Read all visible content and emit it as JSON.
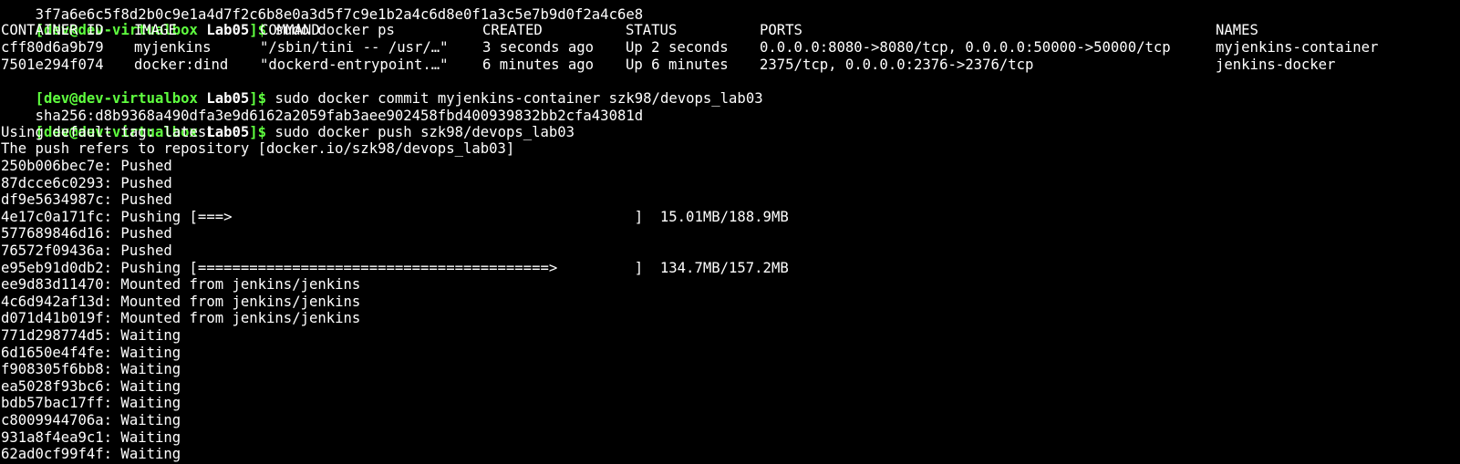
{
  "terminal": {
    "partial_top": "3f7a6e6c5f8d2b0c9e1a4d7f2c6b8e0a3d5f7c9e1b2a4c6d8e0f1a3c5e7b9d0f2a4c6e8",
    "prompt": {
      "user_host": "[dev@dev-virtualbox",
      "dir": "Lab05",
      "close": "]$"
    },
    "cmd1": "sudo docker ps",
    "ps_header": [
      "CONTAINER ID",
      "IMAGE",
      "COMMAND",
      "CREATED",
      "STATUS",
      "PORTS",
      "NAMES"
    ],
    "ps_rows": [
      [
        "cff80d6a9b79",
        "myjenkins",
        "\"/sbin/tini -- /usr/…\"",
        "3 seconds ago",
        "Up 2 seconds",
        "0.0.0.0:8080->8080/tcp, 0.0.0.0:50000->50000/tcp",
        "myjenkins-container"
      ],
      [
        "7501e294f074",
        "docker:dind",
        "\"dockerd-entrypoint.…\"",
        "6 minutes ago",
        "Up 6 minutes",
        "2375/tcp, 0.0.0.0:2376->2376/tcp",
        "jenkins-docker"
      ]
    ],
    "cmd2": "sudo docker commit myjenkins-container szk98/devops_lab03",
    "commit_hash": "sha256:d8b9368a490dfa3e9d6162a2059fab3aee902458fbd400939832bb2cfa43081d",
    "cmd3": "sudo docker push szk98/devops_lab03",
    "output": [
      "Using default tag: latest",
      "The push refers to repository [docker.io/szk98/devops_lab03]",
      "250b006bec7e: Pushed",
      "87dcce6c0293: Pushed",
      "df9e5634987c: Pushed",
      "4e17c0a171fc: Pushing [===>                                               ]  15.01MB/188.9MB",
      "577689846d16: Pushed",
      "76572f09436a: Pushed",
      "e95eb91d0db2: Pushing [=========================================>         ]  134.7MB/157.2MB",
      "ee9d83d11470: Mounted from jenkins/jenkins",
      "4c6d942af13d: Mounted from jenkins/jenkins",
      "d071d41b019f: Mounted from jenkins/jenkins",
      "771d298774d5: Waiting",
      "6d1650e4f4fe: Waiting",
      "f908305f6bb8: Waiting",
      "ea5028f93bc6: Waiting",
      "bdb57bac17ff: Waiting",
      "c8009944706a: Waiting",
      "931a8f4ea9c1: Waiting",
      "62ad0cf99f4f: Waiting"
    ]
  }
}
